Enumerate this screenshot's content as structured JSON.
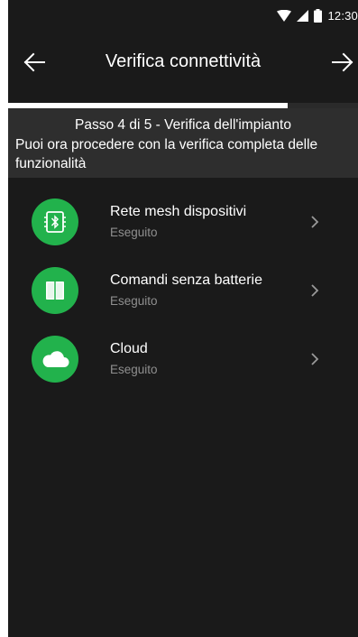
{
  "status_bar": {
    "time": "12:30",
    "icons": [
      "wifi-icon",
      "signal-icon",
      "battery-icon"
    ]
  },
  "app_bar": {
    "title": "Verifica connettività",
    "left_icon": "arrow-left-icon",
    "right_icon": "arrow-right-icon"
  },
  "progress": {
    "current_step": 4,
    "total_steps": 5,
    "fraction": 0.8
  },
  "step": {
    "title": "Passo 4 di 5 - Verifica dell'impianto",
    "description": "Puoi ora procedere con la verifica completa delle funzionalità"
  },
  "checks": [
    {
      "title": "Rete mesh dispositivi",
      "status": "Eseguito",
      "icon": "bluetooth-device-icon"
    },
    {
      "title": "Comandi senza batterie",
      "status": "Eseguito",
      "icon": "switch-panel-icon"
    },
    {
      "title": "Cloud",
      "status": "Eseguito",
      "icon": "cloud-icon"
    }
  ],
  "colors": {
    "background": "#1a1a1a",
    "step_box": "#2e2e2e",
    "accent_green": "#22b24c",
    "subtitle_gray": "#8f8f8f"
  }
}
